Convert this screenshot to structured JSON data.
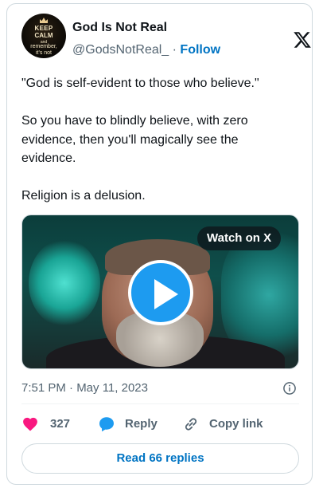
{
  "author": {
    "name": "God Is Not Real",
    "handle": "@GodsNotReal_",
    "separator": "·",
    "follow_label": "Follow",
    "avatar_text": [
      "KEEP",
      "CALM",
      "and",
      "remember,",
      "it's not"
    ]
  },
  "tweet": {
    "paragraphs": [
      [
        "\"God is self-evident to those who believe.\""
      ],
      [
        "So you have to blindly believe, with zero",
        "evidence, then you'll magically see the",
        "evidence."
      ],
      [
        "Religion is a delusion."
      ]
    ],
    "timestamp": "7:51 PM · May 11, 2023"
  },
  "media": {
    "watch_label": "Watch on X"
  },
  "actions": {
    "like_count": "327",
    "reply_label": "Reply",
    "copy_link_label": "Copy link"
  },
  "read_replies_label": "Read 66 replies",
  "colors": {
    "accent": "#1d9bf0",
    "link": "#0074c3",
    "like": "#f91880",
    "muted": "#536471",
    "border": "#cfd9de"
  },
  "icons": [
    "x-logo-icon",
    "play-icon",
    "info-icon",
    "heart-icon",
    "reply-bubble-icon",
    "link-icon"
  ]
}
